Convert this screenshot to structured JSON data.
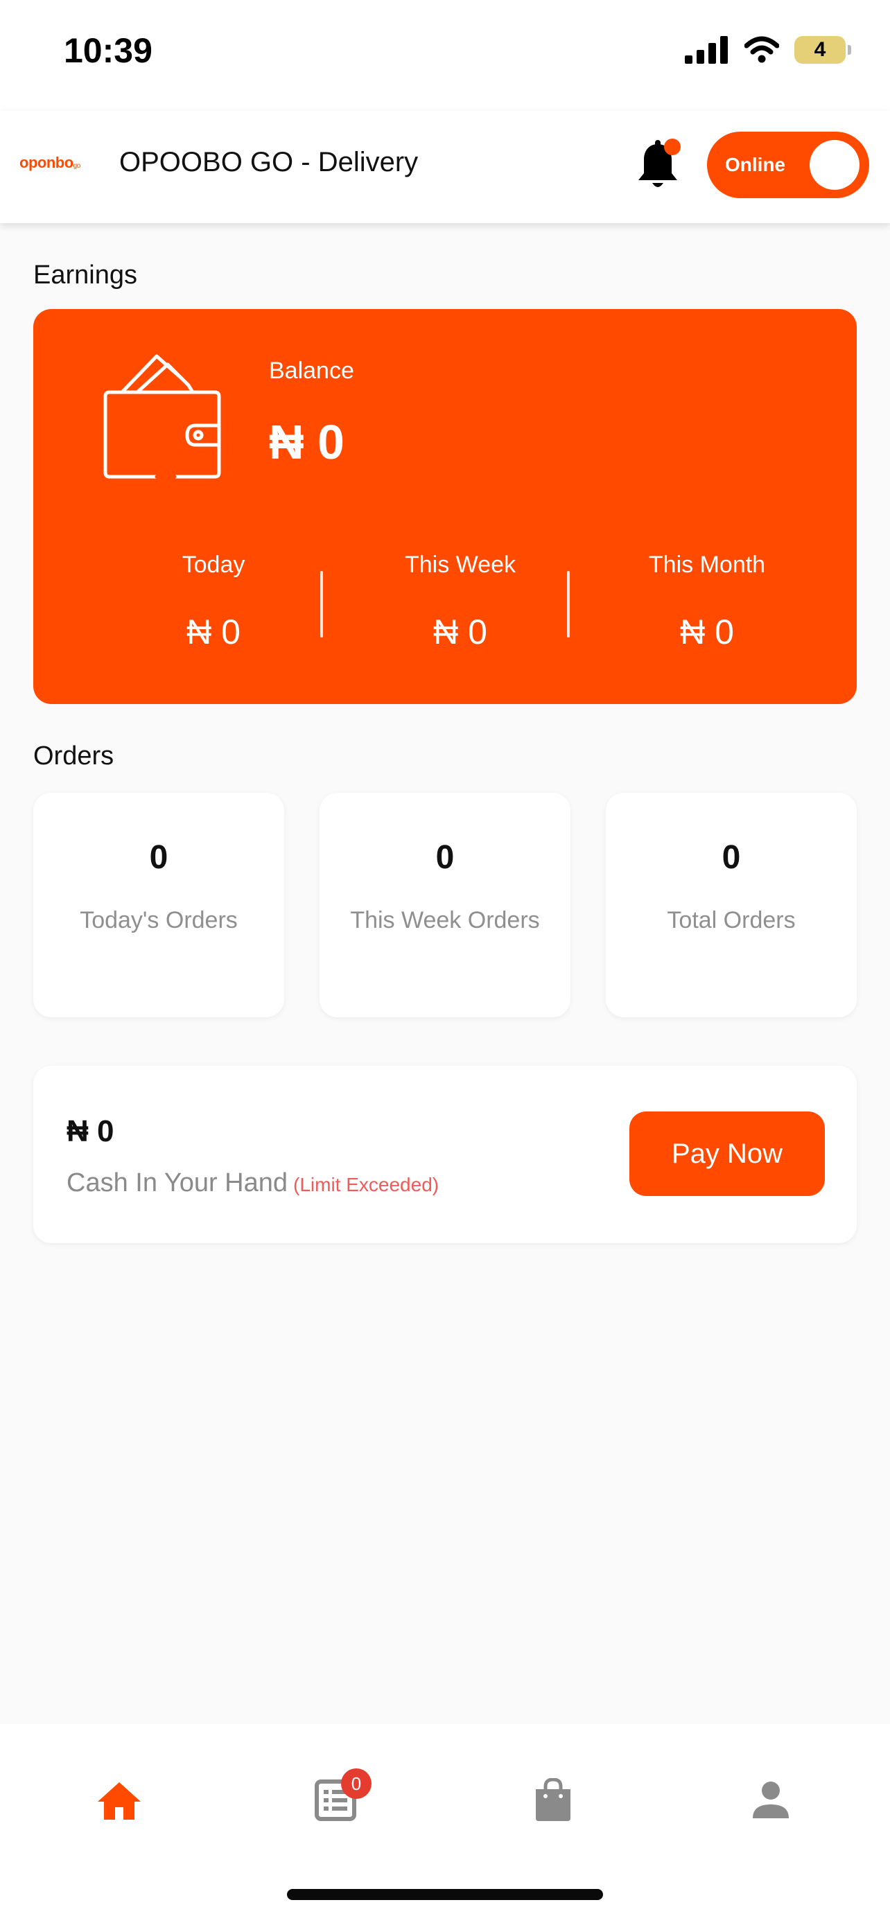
{
  "status_bar": {
    "time": "10:39",
    "battery": "4",
    "icons": [
      "cellular-signal-icon",
      "wifi-icon",
      "battery-icon"
    ]
  },
  "header": {
    "logo_text": "oponbo",
    "logo_suffix": "go",
    "title": "OPOOBO GO - Delivery",
    "notification_icon": "bell-icon",
    "status_toggle_label": "Online",
    "status_toggle_on": true
  },
  "colors": {
    "accent": "#FF4A00",
    "badge": "#E43D30",
    "warning_text": "#F05A5A",
    "muted_text": "#8F8F8F"
  },
  "earnings": {
    "section_title": "Earnings",
    "balance_label": "Balance",
    "balance_value": "₦ 0",
    "wallet_icon": "wallet-icon",
    "periods": [
      {
        "label": "Today",
        "value": "₦ 0"
      },
      {
        "label": "This Week",
        "value": "₦ 0"
      },
      {
        "label": "This Month",
        "value": "₦ 0"
      }
    ]
  },
  "orders": {
    "section_title": "Orders",
    "cards": [
      {
        "count": "0",
        "label": "Today's Orders"
      },
      {
        "count": "0",
        "label": "This Week Orders"
      },
      {
        "count": "0",
        "label": "Total Orders"
      }
    ]
  },
  "cash": {
    "value": "₦ 0",
    "label": "Cash In Your Hand",
    "warning": "(Limit Exceeded)",
    "button_label": "Pay Now"
  },
  "bottom_nav": {
    "items": [
      {
        "icon": "home-icon",
        "active": true
      },
      {
        "icon": "order-list-icon",
        "badge": "0",
        "active": false
      },
      {
        "icon": "shopping-bag-icon",
        "active": false
      },
      {
        "icon": "profile-icon",
        "active": false
      }
    ]
  }
}
